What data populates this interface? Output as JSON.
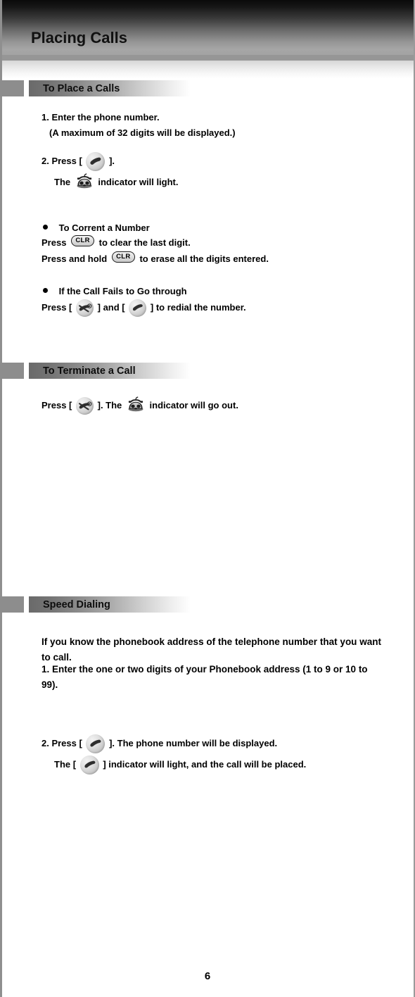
{
  "page": {
    "title": "Placing Calls",
    "number": "6"
  },
  "sections": [
    {
      "id": "to-place-a-calls",
      "heading": "To Place a Calls",
      "lines": {
        "step1": "1. Enter the phone number.",
        "step1_note": "(A maximum of 32 digits will be displayed.)",
        "step2_before": "2. Press [",
        "step2_after": "].",
        "step2_sub_before": "The",
        "step2_sub_after": "indicator will light.",
        "bullet1_title": "To Corrent a Number",
        "bullet1_line1_before": "Press",
        "bullet1_line1_after": "to clear the last digit.",
        "bullet1_line2_before": "Press and hold",
        "bullet1_line2_after": "to erase all the digits entered.",
        "bullet2_title": "If the Call Fails to Go through",
        "bullet2_line1_a": "Press [",
        "bullet2_line1_b": "] and [",
        "bullet2_line1_c": "] to redial the number."
      }
    },
    {
      "id": "to-terminate-a-call",
      "heading": "To Terminate a Call",
      "lines": {
        "line1_a": "Press [",
        "line1_b": "]. The",
        "line1_c": "indicator will go out."
      }
    },
    {
      "id": "speed-dialing",
      "heading": "Speed Dialing",
      "lines": {
        "intro": "If you know the phonebook address of the telephone number that you want to call.",
        "step1": "1. Enter the one or two digits of your Phonebook address (1 to 9 or 10 to 99).",
        "step2_before": "2. Press [",
        "step2_after": "]. The phone number will be displayed.",
        "step2_sub_before": "The [",
        "step2_sub_after": "] indicator will light, and the call will be placed."
      }
    }
  ],
  "key_labels": {
    "clr": "CLR"
  },
  "colors": {
    "banner_top": "#0a0a0a",
    "banner_bottom": "#a3a3a3",
    "rule": "#969696",
    "tab": "#8d8d8d",
    "text": "#000000"
  }
}
